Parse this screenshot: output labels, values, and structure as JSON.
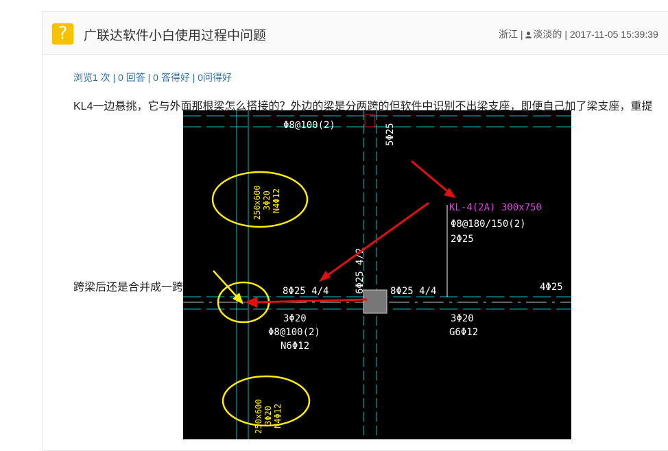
{
  "question": {
    "title": "广联达软件小白使用过程中问题",
    "location": "浙江",
    "author": "淡淡的",
    "datetime": "2017-11-05 15:39:39",
    "stats": "浏览1 次 | 0 回答 | 0 答得好 | 0问得好",
    "body_line1": "KL4一边悬挑，它与外面那根梁怎么搭接的？外边的梁是分两跨的但软件中识别不出梁支座，即便自己加了梁支座，重提",
    "body_line2": "跨梁后还是合并成一跨"
  },
  "cad": {
    "labels": {
      "stirrup_top": "Φ8@100(2)",
      "top_bar": "5Φ25",
      "kl_name": "KL-4(2A) 300x750",
      "kl_stirrup": "Φ8@180/150(2)",
      "kl_top": "2Φ25",
      "col_left_top": "250x600",
      "col_left_top2": "3Φ20",
      "col_left_top3": "N4Φ12",
      "left_bottom": "8Φ25 4/4",
      "mid_vert": "6Φ25 4/2",
      "right_bottom": "8Φ25 4/4",
      "far_right": "4Φ25",
      "under_left1": "3Φ20",
      "under_left2": "Φ8@100(2)",
      "under_left3": "N6Φ12",
      "under_right1": "3Φ20",
      "under_right2": "G6Φ12",
      "col_left_bot": "250x600",
      "col_left_bot2": "3Φ20",
      "col_left_bot3": "N4Φ12"
    },
    "colors": {
      "background": "#000000",
      "axis": "#00c8c8",
      "text": "#ffffff",
      "highlight_ring": "#ffee00",
      "arrow": "#e01010",
      "beam_name": "#e040e0"
    }
  },
  "colors": {
    "accent_icon": "#f6c200",
    "link": "#2b6cad"
  }
}
